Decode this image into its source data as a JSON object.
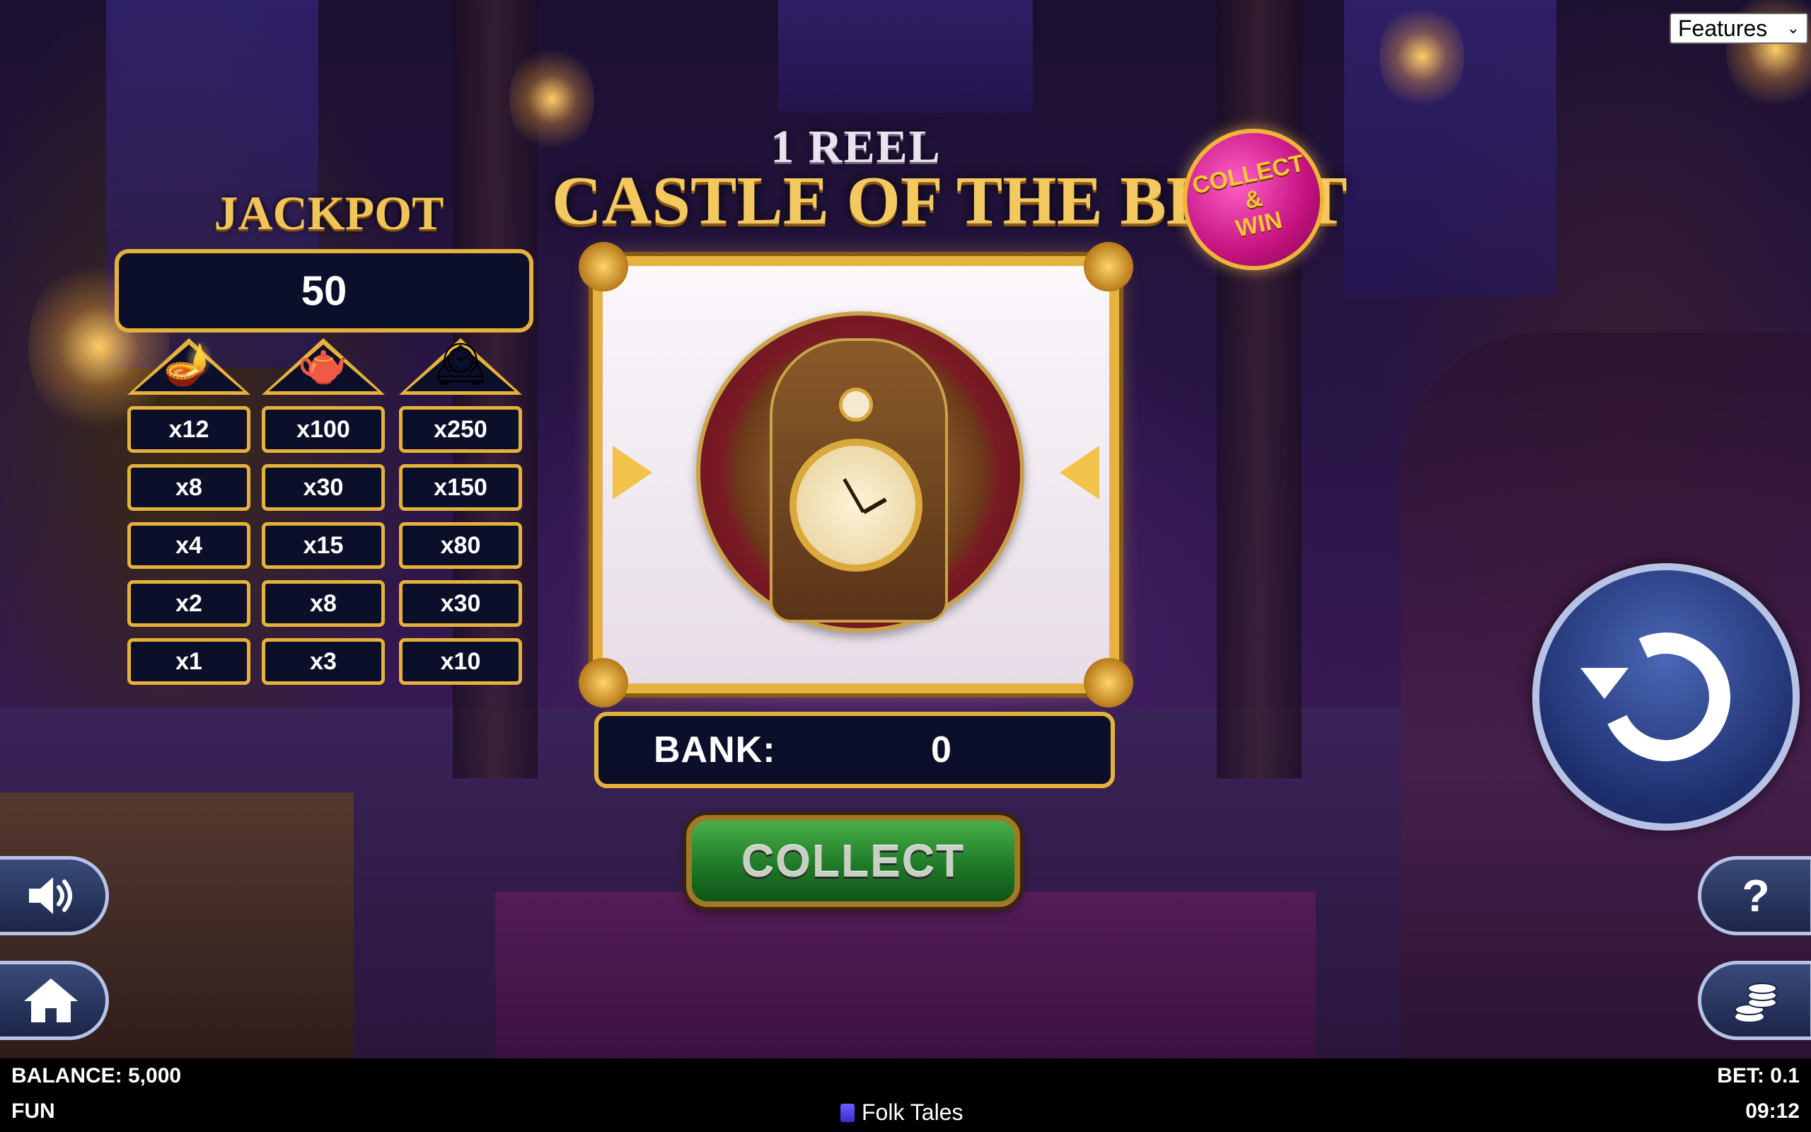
{
  "features_select": {
    "selected": "Features"
  },
  "title": {
    "top": "1 REEL",
    "main": "CASTLE OF THE BEAST"
  },
  "badge": {
    "line1": "COLLECT",
    "line2": "&",
    "line3": "WIN"
  },
  "jackpot": {
    "label": "JACKPOT",
    "value": "50"
  },
  "paytable": {
    "columns": [
      {
        "symbol": "candle-lamp-icon",
        "glyph": "🪔",
        "values": [
          "x12",
          "x8",
          "x4",
          "x2",
          "x1"
        ]
      },
      {
        "symbol": "teapot-icon",
        "glyph": "🫖",
        "values": [
          "x100",
          "x30",
          "x15",
          "x8",
          "x3"
        ]
      },
      {
        "symbol": "clock-icon",
        "glyph": "🕰",
        "values": [
          "x250",
          "x150",
          "x80",
          "x30",
          "x10"
        ]
      }
    ]
  },
  "reel": {
    "symbol": "grandfather-clock-icon"
  },
  "bank": {
    "label": "BANK:",
    "value": "0"
  },
  "collect_button": {
    "label": "COLLECT"
  },
  "side_buttons": {
    "sound": "speaker-icon",
    "home": "home-icon",
    "help": "?",
    "coins": "coins-icon"
  },
  "bottom_bar": {
    "balance": "BALANCE: 5,000",
    "mode": "FUN",
    "brand": "Folk Tales",
    "bet": "BET: 0.1",
    "time": "09:12"
  },
  "colors": {
    "gold": "#e5b13a",
    "panel": "#0c0f2a",
    "collect_green": "#1f7a27",
    "badge_pink": "#c4127f"
  }
}
